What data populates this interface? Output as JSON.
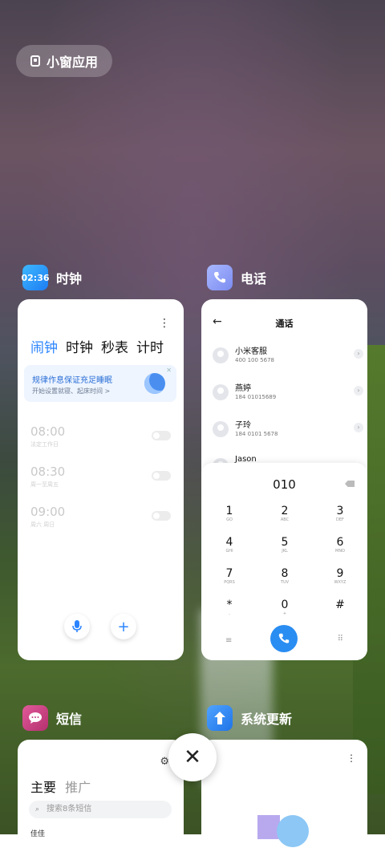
{
  "small_window": {
    "label": "小窗应用"
  },
  "clock": {
    "app_name": "时钟",
    "icon_text": "02:36",
    "tabs": [
      "闹钟",
      "时钟",
      "秒表",
      "计时"
    ],
    "banner_title": "规律作息保证充足睡眠",
    "banner_sub": "开始设置就寝、起床时间 >",
    "alarms": [
      {
        "time": "08:00",
        "sub": "法定工作日"
      },
      {
        "time": "08:30",
        "sub": "周一至周五"
      },
      {
        "time": "09:00",
        "sub": "周六 周日"
      }
    ]
  },
  "phone": {
    "app_name": "电话",
    "title": "通话",
    "contacts": [
      {
        "name": "小米客服",
        "number": "400 100 5678"
      },
      {
        "name": "燕婷",
        "number": "184 01015689"
      },
      {
        "name": "子玲",
        "number": "184 0101 5678"
      },
      {
        "name": "Jason",
        "number": ""
      }
    ],
    "entry": "010",
    "keys": [
      {
        "d": "1",
        "l": "GO"
      },
      {
        "d": "2",
        "l": "ABC"
      },
      {
        "d": "3",
        "l": "DEF"
      },
      {
        "d": "4",
        "l": "GHI"
      },
      {
        "d": "5",
        "l": "JKL"
      },
      {
        "d": "6",
        "l": "MNO"
      },
      {
        "d": "7",
        "l": "PQRS"
      },
      {
        "d": "8",
        "l": "TUV"
      },
      {
        "d": "9",
        "l": "WXYZ"
      },
      {
        "d": "*",
        "l": ","
      },
      {
        "d": "0",
        "l": "+"
      },
      {
        "d": "#",
        "l": ""
      }
    ]
  },
  "sms": {
    "app_name": "短信",
    "tab_main": "主要",
    "tab_promo": "推广",
    "search_placeholder": "搜索8条短信",
    "first_row": "佳佳"
  },
  "update": {
    "app_name": "系统更新"
  },
  "close": {
    "label": "✕"
  }
}
